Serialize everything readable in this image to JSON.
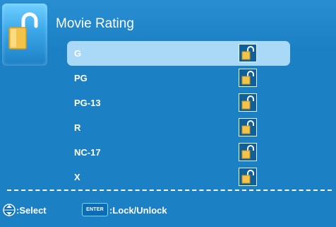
{
  "header": {
    "title": "Movie Rating",
    "icon": "unlock-icon"
  },
  "ratings": [
    {
      "label": "G",
      "locked": false,
      "selected": true
    },
    {
      "label": "PG",
      "locked": false,
      "selected": false
    },
    {
      "label": "PG-13",
      "locked": false,
      "selected": false
    },
    {
      "label": "R",
      "locked": false,
      "selected": false
    },
    {
      "label": "NC-17",
      "locked": false,
      "selected": false
    },
    {
      "label": "X",
      "locked": false,
      "selected": false
    }
  ],
  "footer": {
    "select_label": ":Select",
    "enter_key": "ENTER",
    "lock_label": ":Lock/Unlock"
  },
  "colors": {
    "background": "#1c80c4",
    "highlight": "#a9d9f6"
  }
}
